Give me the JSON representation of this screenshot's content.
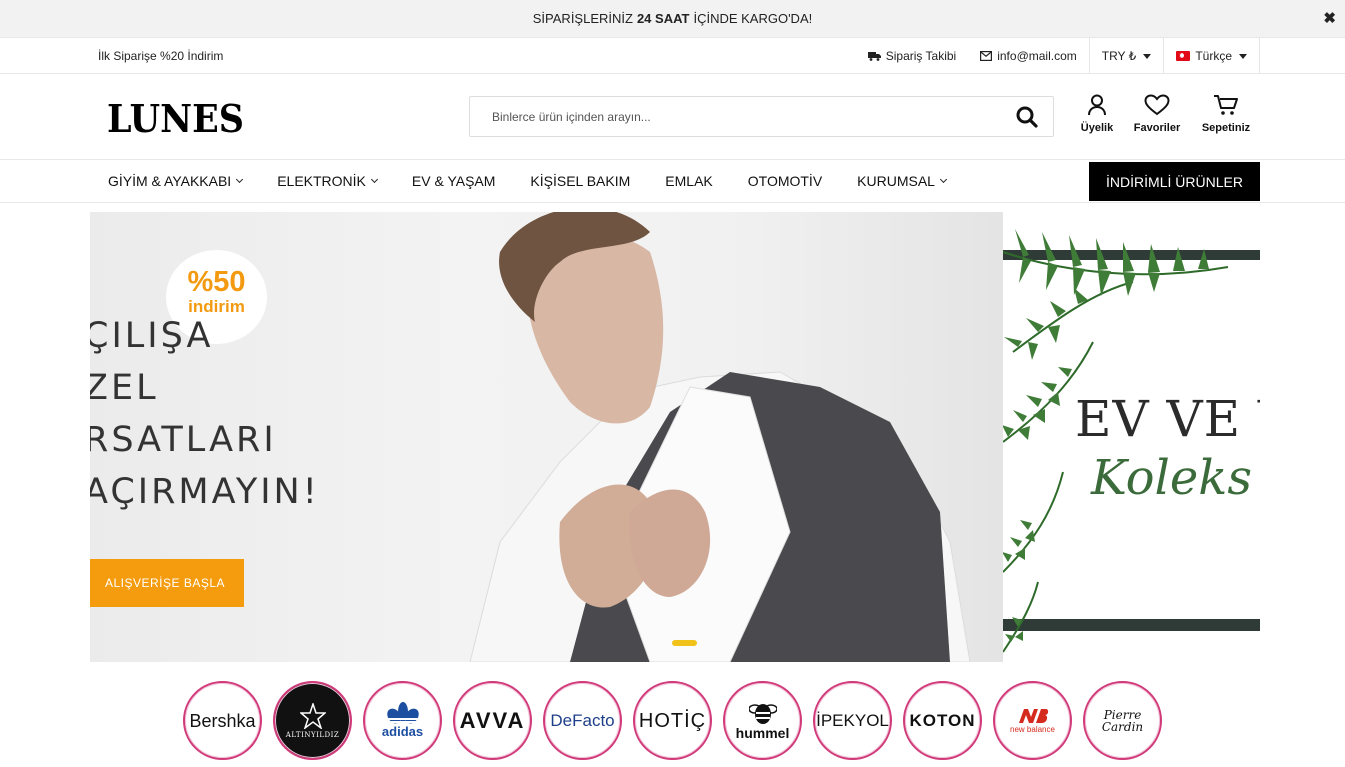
{
  "announcement": {
    "pre": "SİPARİŞLERİNİZ",
    "bold": "24 SAAT",
    "post": "İÇİNDE KARGO'DA!",
    "close": "✖"
  },
  "topbar": {
    "promo": "İlk Siparişe %20 İndirim",
    "tracking": "Sipariş Takibi",
    "email": "info@mail.com",
    "currency": "TRY ₺",
    "language": "Türkçe"
  },
  "header": {
    "logo": "LUNES",
    "search_placeholder": "Binlerce ürün içinden arayın...",
    "account": "Üyelik",
    "favorites": "Favoriler",
    "cart": "Sepetiniz"
  },
  "nav": {
    "items": [
      {
        "label": "GİYİM & AYAKKABI"
      },
      {
        "label": "ELEKTRONİK"
      },
      {
        "label": "EV & YAŞAM"
      },
      {
        "label": "KİŞİSEL BAKIM"
      },
      {
        "label": "EMLAK"
      },
      {
        "label": "OTOMOTİV"
      },
      {
        "label": "KURUMSAL"
      }
    ],
    "sale": "İNDİRİMLİ ÜRÜNLER"
  },
  "slider": {
    "badge_pct": "%50",
    "badge_text": "indirim",
    "title_lines": [
      "ÇILIŞA",
      "ZEL",
      "RSATLARI",
      "AÇIRMAYIN!"
    ],
    "cta": "ALIŞVERİŞE BAŞLA",
    "next_title": "EV VE Y",
    "next_subtitle": "Koleks"
  },
  "brands": [
    "Bershka",
    "ALTINYILDIZ",
    "adidas",
    "AVVA",
    "DeFacto",
    "HOTİÇ",
    "hummel",
    "İPEKYOL",
    "KOTON",
    "new balance",
    "Pierre Cardin"
  ],
  "colors": {
    "accent": "#f59c0e",
    "brand_ring": "#d13a7a",
    "dot": "#f1c21a"
  }
}
